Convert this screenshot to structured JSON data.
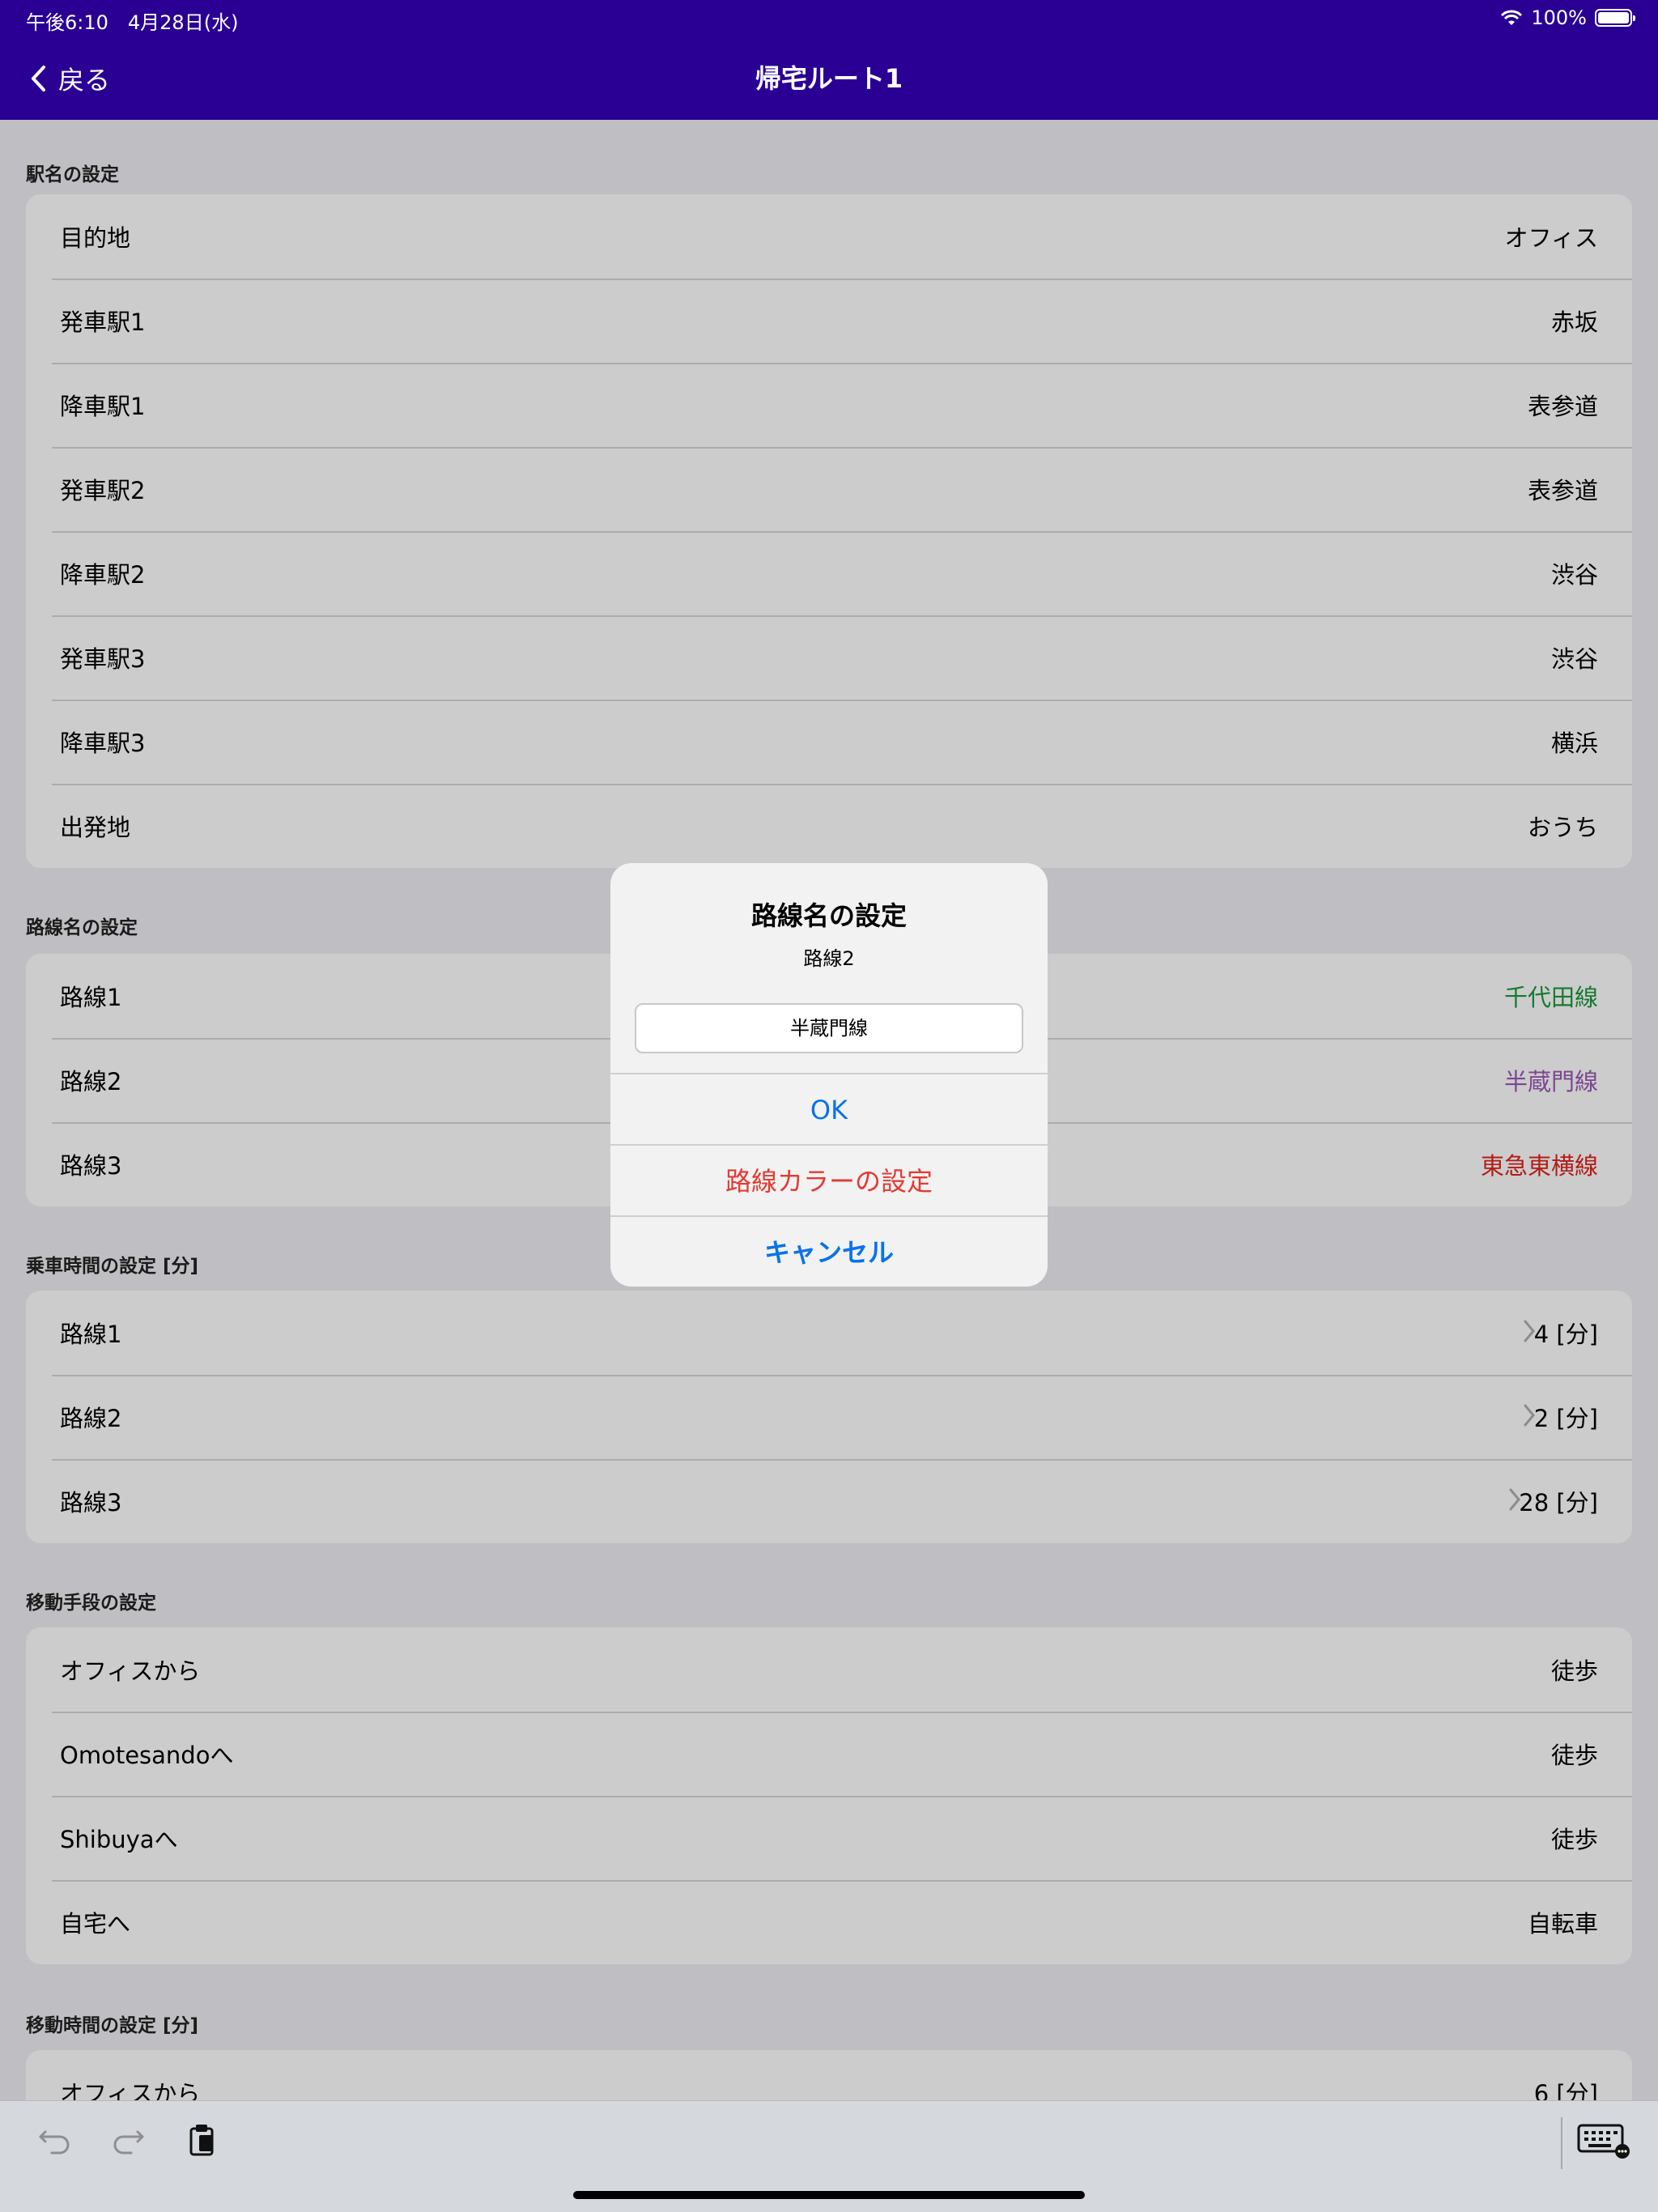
{
  "status_bar": {
    "time": "午後6:10　4月28日(水)",
    "battery": "100%"
  },
  "nav": {
    "back_label": "戻る",
    "title": "帰宅ルート1"
  },
  "sections": [
    {
      "header": "駅名の設定",
      "rows": [
        {
          "label": "目的地",
          "value": "オフィス"
        },
        {
          "label": "発車駅1",
          "value": "赤坂"
        },
        {
          "label": "降車駅1",
          "value": "表参道"
        },
        {
          "label": "発車駅2",
          "value": "表参道"
        },
        {
          "label": "降車駅2",
          "value": "渋谷"
        },
        {
          "label": "発車駅3",
          "value": "渋谷"
        },
        {
          "label": "降車駅3",
          "value": "横浜"
        },
        {
          "label": "出発地",
          "value": "おうち"
        }
      ]
    },
    {
      "header": "路線名の設定",
      "rows": [
        {
          "label": "路線1",
          "value": "千代田線",
          "color": "#1a9a3c"
        },
        {
          "label": "路線2",
          "value": "半蔵門線",
          "color": "#9b59b6"
        },
        {
          "label": "路線3",
          "value": "東急東横線",
          "color": "#e0241c"
        }
      ]
    },
    {
      "header": "乗車時間の設定 [分]",
      "rows": [
        {
          "label": "路線1",
          "value": "4 [分]",
          "chevron": true
        },
        {
          "label": "路線2",
          "value": "2 [分]",
          "chevron": true
        },
        {
          "label": "路線3",
          "value": "28 [分]",
          "chevron": true
        }
      ]
    },
    {
      "header": "移動手段の設定",
      "rows": [
        {
          "label": "オフィスから",
          "value": "徒歩"
        },
        {
          "label": "Omotesandoへ",
          "value": "徒歩"
        },
        {
          "label": "Shibuyaへ",
          "value": "徒歩"
        },
        {
          "label": "自宅へ",
          "value": "自転車"
        }
      ]
    },
    {
      "header": "移動時間の設定 [分]",
      "rows": [
        {
          "label": "オフィスから",
          "value": "6 [分]"
        }
      ]
    }
  ],
  "alert": {
    "title": "路線名の設定",
    "message": "路線2",
    "input_value": "半蔵門線",
    "ok_label": "OK",
    "color_label": "路線カラーの設定",
    "cancel_label": "キャンセル"
  },
  "toolbar": {
    "icons": [
      "undo-icon",
      "redo-icon",
      "paste-icon",
      "keyboard-icon"
    ]
  }
}
